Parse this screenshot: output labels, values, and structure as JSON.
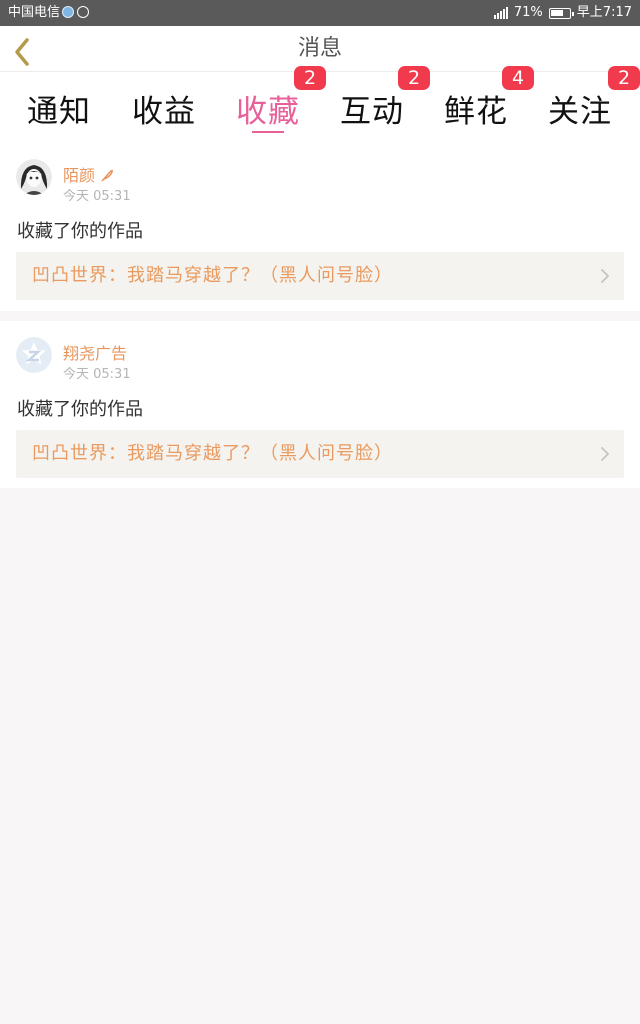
{
  "status_bar": {
    "carrier": "中国电信",
    "battery": "71%",
    "battery_level": 0.71,
    "time": "早上7:17"
  },
  "header": {
    "title": "消息",
    "back_icon": "chevron-left-icon"
  },
  "tabs": [
    {
      "label": "通知",
      "badge": "",
      "active": false
    },
    {
      "label": "收益",
      "badge": "",
      "active": false
    },
    {
      "label": "收藏",
      "badge": "2",
      "active": true
    },
    {
      "label": "互动",
      "badge": "2",
      "active": false
    },
    {
      "label": "鲜花",
      "badge": "4",
      "active": false
    },
    {
      "label": "关注",
      "badge": "2",
      "active": false
    }
  ],
  "messages": [
    {
      "username": "陌颜",
      "verified_icon": "feather-icon",
      "time": "今天 05:31",
      "action": "收藏了你的作品",
      "work_title": "凹凸世界：我踏马穿越了？（黑人问号脸）"
    },
    {
      "username": "翔尧广告",
      "time": "今天 05:31",
      "action": "收藏了你的作品",
      "work_title": "凹凸世界：我踏马穿越了？（黑人问号脸）"
    }
  ],
  "colors": {
    "accent": "#e8609a",
    "badge": "#f23a4d",
    "username": "#e8955d",
    "work_title": "#ea9a5e"
  }
}
